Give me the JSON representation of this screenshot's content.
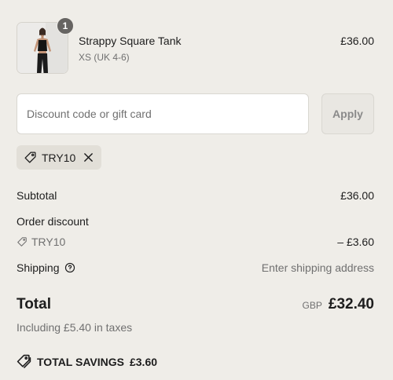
{
  "product": {
    "quantity": "1",
    "name": "Strappy Square Tank",
    "variant": "XS (UK 4-6)",
    "price": "£36.00"
  },
  "discount": {
    "placeholder": "Discount code or gift card",
    "apply_label": "Apply",
    "applied_code": "TRY10"
  },
  "summary": {
    "subtotal_label": "Subtotal",
    "subtotal_value": "£36.00",
    "order_discount_label": "Order discount",
    "discount_code": "TRY10",
    "discount_value": "– £3.60",
    "shipping_label": "Shipping",
    "shipping_value": "Enter shipping address",
    "total_label": "Total",
    "currency": "GBP",
    "total_value": "£32.40",
    "taxes_text": "Including £5.40 in taxes",
    "savings_label": "TOTAL SAVINGS",
    "savings_value": "£3.60"
  },
  "icons": {
    "tag": "tag-icon",
    "close": "close-icon",
    "help": "help-circle-icon",
    "savings": "tags-icon"
  }
}
